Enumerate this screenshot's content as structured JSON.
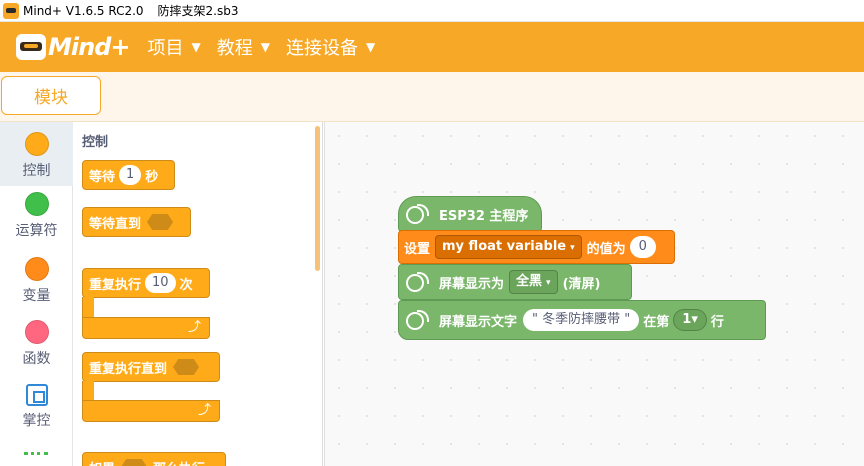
{
  "titlebar": {
    "app_name": "Mind+ V1.6.5 RC2.0",
    "filename": "防摔支架2.sb3"
  },
  "logo": {
    "text": "Mind+"
  },
  "menu": [
    {
      "label": "项目"
    },
    {
      "label": "教程"
    },
    {
      "label": "连接设备"
    }
  ],
  "tab": {
    "label": "模块"
  },
  "categories": [
    {
      "label": "控制",
      "color": "#ffab19"
    },
    {
      "label": "运算符",
      "color": "#40bf4a"
    },
    {
      "label": "变量",
      "color": "#ff8c1a"
    },
    {
      "label": "函数",
      "color": "#ff6680"
    },
    {
      "label": "掌控",
      "icon": "chip-icon"
    }
  ],
  "palette": {
    "title": "控制",
    "wait": {
      "prefix": "等待",
      "value": "1",
      "suffix": "秒"
    },
    "wait_until": {
      "label": "等待直到"
    },
    "repeat": {
      "prefix": "重复执行",
      "value": "10",
      "suffix": "次",
      "loop_arrow": "⤴"
    },
    "repeat_until": {
      "label": "重复执行直到",
      "loop_arrow": "⤴"
    },
    "if_then": {
      "prefix": "如果",
      "suffix": "那么执行"
    }
  },
  "workspace": {
    "main": {
      "label": "ESP32 主程序"
    },
    "set_var": {
      "prefix": "设置",
      "variable": "my float variable",
      "middle": "的值为",
      "value": "0"
    },
    "fill_screen": {
      "prefix": "屏幕显示为",
      "option": "全黑",
      "suffix": "(清屏)"
    },
    "show_text": {
      "prefix": "屏幕显示文字",
      "text": "\" 冬季防摔腰带 \"",
      "middle": "在第",
      "line": "1",
      "suffix": "行"
    }
  },
  "dropdown_caret": "▾",
  "menu_caret": "▼"
}
